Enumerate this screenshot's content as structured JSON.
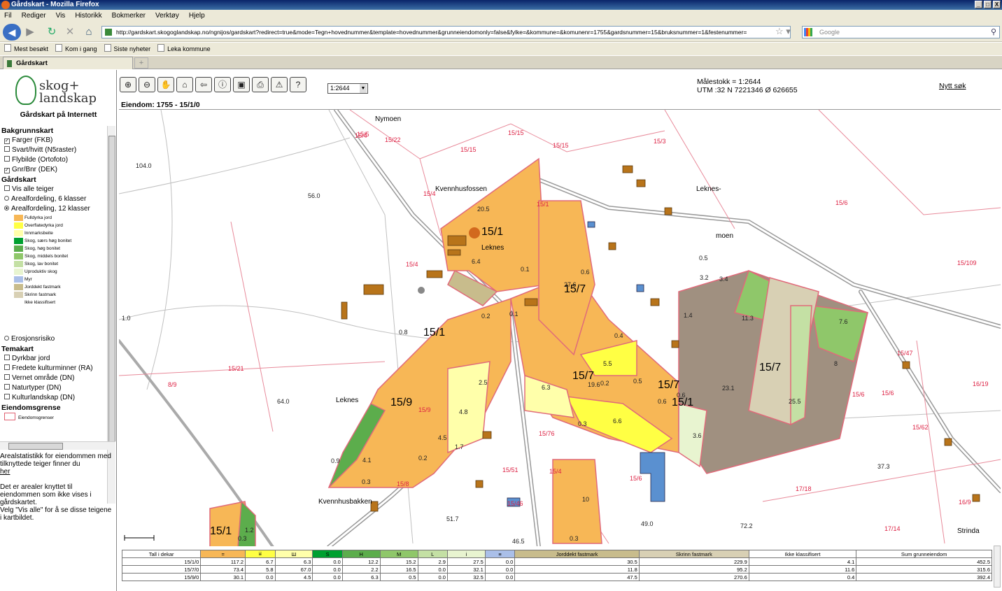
{
  "window": {
    "title": "Gårdskart - Mozilla Firefox",
    "controls": [
      "_",
      "□",
      "X"
    ]
  },
  "menu": [
    "Fil",
    "Rediger",
    "Vis",
    "Historikk",
    "Bokmerker",
    "Verktøy",
    "Hjelp"
  ],
  "nav": {
    "url": "http://gardskart.skogoglandskap.no/ngnijos/gardskart?redirect=true&mode=Tegn+hovednummer&template=hovednummer&grunneiendomonly=false&fylke=&kommune=&komunenr=1755&gardsnummer=15&bruksnummer=1&festenummer=",
    "search_placeholder": "Google"
  },
  "bookmarks": [
    "Mest besøkt",
    "Kom i gang",
    "Siste nyheter",
    "Leka kommune"
  ],
  "tab": {
    "label": "Gårdskart"
  },
  "sidebar": {
    "logo_line1": "skog+",
    "logo_line2": "landskap",
    "site_title": "Gårdskart på Internett",
    "bakgrunn_title": "Bakgrunnskart",
    "bakgrunn": [
      {
        "label": "Farger (FKB)",
        "checked": true
      },
      {
        "label": "Svart/hvitt (N5raster)",
        "checked": false
      },
      {
        "label": "Flybilde (Ortofoto)",
        "checked": false
      },
      {
        "label": "Gnr/Bnr (DEK)",
        "checked": true
      }
    ],
    "gardskart_title": "Gårdskart",
    "vis_alle": "Vis alle teiger",
    "areal6": "Arealfordeling, 6 klasser",
    "areal12": "Arealfordeling, 12 klasser",
    "legend": [
      {
        "label": "Fulldyrka jord",
        "color": "#f7b756"
      },
      {
        "label": "Overflatedyrka jord",
        "color": "#ffff44"
      },
      {
        "label": "Innmarksbeite",
        "color": "#ffffaa"
      },
      {
        "label": "Skog, særs høg bonitet",
        "color": "#00a030"
      },
      {
        "label": "Skog, høg bonitet",
        "color": "#5cad4c"
      },
      {
        "label": "Skog, middels bonitet",
        "color": "#8fc76a"
      },
      {
        "label": "Skog, lav bonitet",
        "color": "#c4e0a4"
      },
      {
        "label": "Uproduktiv skog",
        "color": "#e8f4d0"
      },
      {
        "label": "Myr",
        "color": "#aabfe8"
      },
      {
        "label": "Jorddekt fastmark",
        "color": "#c8bc8c"
      },
      {
        "label": "Skrinn fastmark",
        "color": "#d8d0b4"
      },
      {
        "label": "Ikke klassifisert",
        "color": "#ffffff"
      }
    ],
    "erosjon": "Erosjonsrisiko",
    "tema_title": "Temakart",
    "tema": [
      "Dyrkbar jord",
      "Fredete kulturminner (RA)",
      "Vernet område (DN)",
      "Naturtyper (DN)",
      "Kulturlandskap (DN)"
    ],
    "eiendom_title": "Eiendomsgrense",
    "eiendom_legend": "Eiendomsgrenser",
    "note1": "Arealstatistikk for eiendommen med tilknyttede teiger finner du",
    "note_link": "her",
    "note2": "Det er arealer knyttet til eiendommen som ikke vises i gårdskartet.",
    "note3": "Velg \"Vis alle\" for å se disse teigene i kartbildet."
  },
  "main": {
    "toolbar": [
      "zoom-in",
      "zoom-out",
      "pan",
      "home",
      "back",
      "info",
      "save",
      "print",
      "warning",
      "help"
    ],
    "toolbar_glyphs": [
      "⊕",
      "⊖",
      "✋",
      "⌂",
      "⇦",
      "ⓘ",
      "▣",
      "⎙",
      "⚠",
      "?"
    ],
    "scale_value": "1:2644",
    "malestokk": "Målestokk = 1:2644",
    "utm": "UTM :32 N 7221346 Ø 626655",
    "nytt_sok": "Nytt søk",
    "eiendom": "Eiendom: 1755 - 15/1/0"
  },
  "map_labels": {
    "big": [
      "15/1",
      "15/7",
      "15/1",
      "15/7",
      "15/1",
      "15/7",
      "15/1",
      "15/7",
      "15/9",
      "15/7",
      "15/1"
    ],
    "places": [
      "Nymoen",
      "Kvennhusfossen",
      "Leknes",
      "Leknes-",
      "moen",
      "Leknes",
      "Kvennhusbakken",
      "Strinda"
    ],
    "parcels": [
      "15/4",
      "15/22",
      "15/15",
      "15/15",
      "15/15",
      "15/3",
      "15/6",
      "15/4",
      "15/1",
      "15/4",
      "15/109",
      "15/21",
      "8/9",
      "15/6",
      "15/9",
      "15/76",
      "15/51",
      "15/8",
      "15/4",
      "15/6",
      "17/18",
      "17/14",
      "15/62",
      "16/19",
      "16/9",
      "15/47",
      "15/6",
      "15/46",
      "15/5"
    ],
    "values": [
      "20.5",
      "6.4",
      "0.1",
      "0.6",
      "27.6",
      "0.2",
      "0.1",
      "0.8",
      "0.4",
      "5.5",
      "19.6",
      "0.2",
      "0.5",
      "6.3",
      "2.5",
      "4.8",
      "4.5",
      "1.7",
      "0.9",
      "4.1",
      "0.3",
      "0.2",
      "6.6",
      "0.3",
      "0.6",
      "0.6",
      "3.6",
      "3.2",
      "3.4",
      "11.3",
      "7.6",
      "1.4",
      "0.5",
      "23.1",
      "25.5",
      "8",
      "10",
      "0.3",
      "0.3",
      "1.2"
    ],
    "heights": [
      "104.0",
      "56.0",
      "64.0",
      "51.7",
      "46.5",
      "37.3",
      "72.2",
      "49.0",
      "1.0"
    ]
  },
  "stats": {
    "headers": [
      "Tall i dekar",
      "=",
      "⩸",
      "Ш",
      "S",
      "H",
      "M",
      "L",
      "i",
      "≡",
      "Jorddekt fastmark",
      "Skrinn fastmark",
      "Ikke klassifisert",
      "Sum grunneiendom"
    ],
    "header_colors": [
      "#ffffff",
      "#f7b756",
      "#ffff44",
      "#ffffaa",
      "#00a030",
      "#5cad4c",
      "#8fc76a",
      "#c4e0a4",
      "#e8f4d0",
      "#aabfe8",
      "#c8bc8c",
      "#d8d0b4",
      "#ffffff",
      "#ffffff"
    ],
    "rows": [
      [
        "15/1/0",
        "117.2",
        "6.7",
        "6.3",
        "0.0",
        "12.2",
        "15.2",
        "2.9",
        "27.5",
        "0.0",
        "30.5",
        "229.9",
        "4.1",
        "452.5"
      ],
      [
        "15/7/0",
        "73.4",
        "5.8",
        "67.0",
        "0.0",
        "2.2",
        "16.5",
        "0.0",
        "32.1",
        "0.0",
        "11.8",
        "95.2",
        "11.6",
        "315.6"
      ],
      [
        "15/9/0",
        "30.1",
        "0.0",
        "4.5",
        "0.0",
        "6.3",
        "0.5",
        "0.0",
        "32.5",
        "0.0",
        "47.5",
        "270.6",
        "0.4",
        "392.4"
      ]
    ]
  }
}
